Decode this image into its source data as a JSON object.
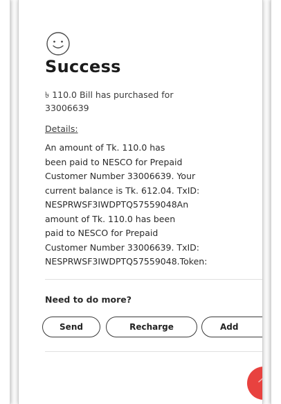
{
  "success": {
    "icon": "smiley-face-icon",
    "title": "Success",
    "summary_line1": "৳ 110.0 Bill has purchased for",
    "summary_line2": "33006639"
  },
  "details": {
    "label": "Details:",
    "text": "An amount of Tk. 110.0 has\nbeen paid to NESCO for Prepaid\nCustomer Number 33006639. Your\ncurrent balance is Tk. 612.04. TxID:\nNESPRWSF3IWDPTQ57559048An\namount of Tk. 110.0 has been\npaid to NESCO for Prepaid\nCustomer Number 33006639. TxID:\nNESPRWSF3IWDPTQ57559048.Token:"
  },
  "more": {
    "heading": "Need to do more?",
    "actions": [
      {
        "label": "Send"
      },
      {
        "label": "Recharge"
      },
      {
        "label": "Add"
      }
    ]
  },
  "fab": {
    "icon": "chevron-up-icon",
    "color": "#e8423f"
  }
}
